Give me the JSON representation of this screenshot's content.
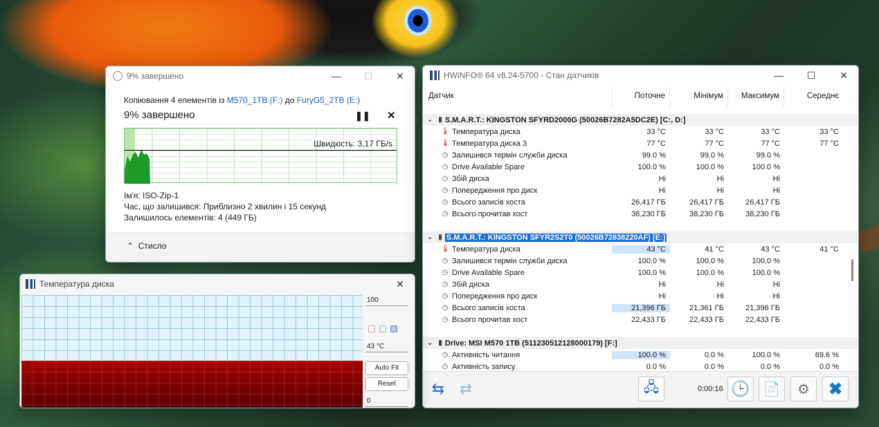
{
  "copy": {
    "title": "9% завершено",
    "line_prefix": "Копіювання 4 елементів із",
    "src": "M570_1TB (F:)",
    "to": "до",
    "dst": "FuryG5_2TB (E:)",
    "headline": "9% завершено",
    "speed": "Швидкість: 3,17 ГБ/s",
    "progress": 0.09,
    "name": "Ім'я:  ISO-Zip-1",
    "remaining": "Час, що залишився:  Приблизно 2 хвилин і 15 секунд",
    "items_left": "Залишилось елементів:  4 (449 ГБ)",
    "collapse": "Стисло"
  },
  "hw": {
    "title": "HWiNFO® 64 v8.24-5700 - Стан датчиків",
    "cols": [
      "Датчик",
      "Поточне",
      "Мінімум",
      "Максимум",
      "Середнє"
    ],
    "rows": [
      {
        "g": 1,
        "n": "S.M.A.R.T.: KINGSTON SFYRD2000G (50026B7282A5DC2E) [C:, D:]"
      },
      {
        "i": "therm",
        "n": "Температура диска",
        "v": [
          "33 °C",
          "33 °C",
          "33 °C",
          "33 °C"
        ]
      },
      {
        "i": "therm",
        "n": "Температура диска 3",
        "v": [
          "77 °C",
          "77 °C",
          "77 °C",
          "77 °C"
        ]
      },
      {
        "i": "clock",
        "n": "Залишився термін служби диска",
        "v": [
          "99.0 %",
          "99.0 %",
          "99.0 %",
          ""
        ]
      },
      {
        "i": "clock",
        "n": "Drive Available Spare",
        "v": [
          "100.0 %",
          "100.0 %",
          "100.0 %",
          ""
        ]
      },
      {
        "i": "clock",
        "n": "Збій диска",
        "v": [
          "Ні",
          "Ні",
          "Ні",
          ""
        ]
      },
      {
        "i": "clock",
        "n": "Попередження про диск",
        "v": [
          "Ні",
          "Ні",
          "Ні",
          ""
        ]
      },
      {
        "i": "clock",
        "n": "Всього записів хоста",
        "v": [
          "26,417 ГБ",
          "26,417 ГБ",
          "26,417 ГБ",
          ""
        ]
      },
      {
        "i": "clock",
        "n": "Всього прочитав хост",
        "v": [
          "38,230 ГБ",
          "38,230 ГБ",
          "38,230 ГБ",
          ""
        ]
      },
      {
        "sp": 1
      },
      {
        "g": 1,
        "sel": 1,
        "n": "S.M.A.R.T.: KINGSTON SFYR2S2T0 (50026B72838220AF) [E:]"
      },
      {
        "i": "therm",
        "n": "Температура диска",
        "v": [
          "43 °C",
          "41 °C",
          "43 °C",
          "41 °C"
        ],
        "hl": 1
      },
      {
        "i": "clock",
        "n": "Залишився термін служби диска",
        "v": [
          "100.0 %",
          "100.0 %",
          "100.0 %",
          ""
        ]
      },
      {
        "i": "clock",
        "n": "Drive Available Spare",
        "v": [
          "100.0 %",
          "100.0 %",
          "100.0 %",
          ""
        ]
      },
      {
        "i": "clock",
        "n": "Збій диска",
        "v": [
          "Ні",
          "Ні",
          "Ні",
          ""
        ]
      },
      {
        "i": "clock",
        "n": "Попередження про диск",
        "v": [
          "Ні",
          "Ні",
          "Ні",
          ""
        ]
      },
      {
        "i": "clock",
        "n": "Всього записів хоста",
        "v": [
          "21,396 ГБ",
          "21,361 ГБ",
          "21,396 ГБ",
          ""
        ],
        "hl": 1
      },
      {
        "i": "clock",
        "n": "Всього прочитав хост",
        "v": [
          "22,433 ГБ",
          "22,433 ГБ",
          "22,433 ГБ",
          ""
        ]
      },
      {
        "sp": 1
      },
      {
        "g": 1,
        "n": "Drive: MSI M570 1TB (511230512128000179) [F:]"
      },
      {
        "i": "clock",
        "n": "Активність читання",
        "v": [
          "100.0 %",
          "0.0 %",
          "100.0 %",
          "69.6 %"
        ],
        "hl": 1
      },
      {
        "i": "clock",
        "n": "Активність запису",
        "v": [
          "0.0 %",
          "0.0 %",
          "0.0 %",
          "0.0 %"
        ]
      }
    ],
    "timer": "0:00:16"
  },
  "dt": {
    "title": "Температура диска",
    "max": "100",
    "current": "43 °C",
    "autofit": "Auto Fit",
    "reset": "Reset",
    "min": "0",
    "level": 0.43
  }
}
